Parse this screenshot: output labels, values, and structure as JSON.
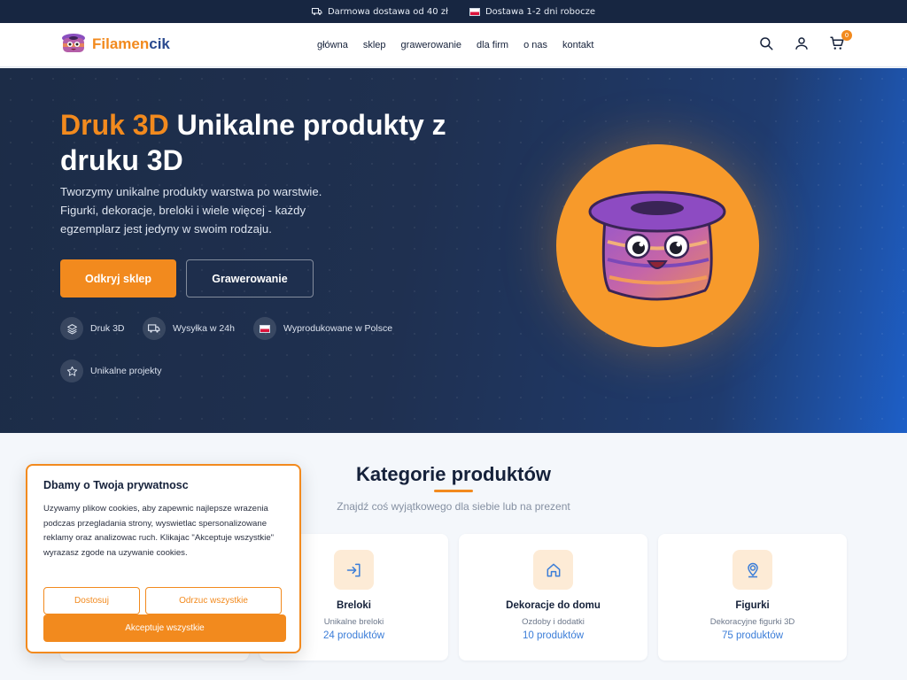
{
  "topbar": {
    "shipping_text": "Darmowa dostawa od 40 zł",
    "delivery_text": "Dostawa 1-2 dni robocze"
  },
  "header": {
    "brand_main": "Filamen",
    "brand_accent": "cik",
    "nav": [
      "główna",
      "sklep",
      "grawerowanie",
      "dla firm",
      "o nas",
      "kontakt"
    ],
    "icons": [
      "search-icon",
      "user-icon",
      "cart-icon"
    ],
    "cart_count": "0"
  },
  "hero": {
    "title_accent": "Druk 3D",
    "title_rest": "Unikalne produkty z druku 3D",
    "lead": "Tworzymy unikalne produkty warstwa po warstwie. Figurki, dekoracje, breloki i wiele więcej - każdy egzemplarz jest jedyny w swoim rodzaju.",
    "primary_button": "Odkryj sklep",
    "secondary_button": "Grawerowanie",
    "features": [
      {
        "label": "Druk 3D",
        "icon": "layers-icon"
      },
      {
        "label": "Wysyłka w 24h",
        "icon": "truck-icon"
      },
      {
        "label": "Wyprodukowane w Polsce",
        "icon": "flag-icon"
      },
      {
        "label": "Unikalne projekty",
        "icon": "star-icon"
      }
    ]
  },
  "categories": {
    "title": "Kategorie produktów",
    "subtitle": "Znajdź coś wyjątkowego dla siebie lub na prezent",
    "items": [
      {
        "name": "Breloki",
        "desc": "Unikalne breloki",
        "count": "24 produktów",
        "icon": "login-arrow-icon"
      },
      {
        "name": "Dekoracje do domu",
        "desc": "Ozdoby i dodatki",
        "count": "10 produktów",
        "icon": "home-icon"
      },
      {
        "name": "Figurki",
        "desc": "Dekoracyjne figurki 3D",
        "count": "75 produktów",
        "icon": "map-pin-icon"
      }
    ]
  },
  "cookie": {
    "title": "Dbamy o Twoja prywatnosc",
    "text": "Uzywamy plikow cookies, aby zapewnic najlepsze wrazenia podczas przegladania strony, wyswietlac spersonalizowane reklamy oraz analizowac ruch. Klikajac \"Akceptuje wszystkie\" wyrazasz zgode na uzywanie cookies.",
    "customize_button": "Dostosuj",
    "reject_button": "Odrzuc wszystkie",
    "accept_button": "Akceptuje wszystkie"
  },
  "colors": {
    "accent": "#f28a1e",
    "navy": "#172641",
    "link": "#3b7dd8"
  }
}
